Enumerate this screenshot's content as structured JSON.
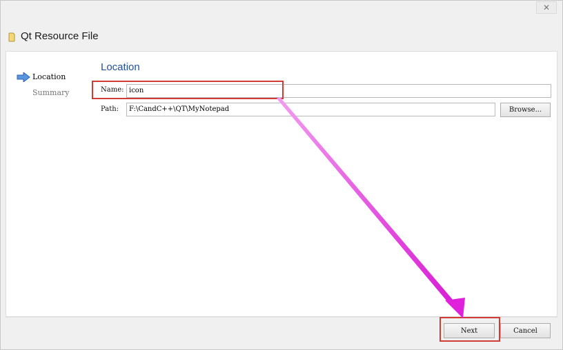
{
  "window": {
    "title": "Qt Resource File",
    "close_glyph": "✕",
    "title_icon": "document-icon"
  },
  "steps": [
    {
      "label": "Location",
      "active": true,
      "icon": "arrow-right-icon"
    },
    {
      "label": "Summary",
      "active": false
    }
  ],
  "page": {
    "heading": "Location"
  },
  "form": {
    "name_label": "Name:",
    "name_value": "icon",
    "path_label": "Path:",
    "path_value": "F:\\CandC++\\QT\\MyNotepad",
    "browse_label": "Browse..."
  },
  "footer": {
    "next_label": "Next",
    "cancel_label": "Cancel"
  },
  "annotations": {
    "highlight_color": "#d23b34",
    "arrow_color": "#e040e0"
  },
  "colors": {
    "heading": "#1f4e9a",
    "step_arrow": "#3a7bd5"
  }
}
